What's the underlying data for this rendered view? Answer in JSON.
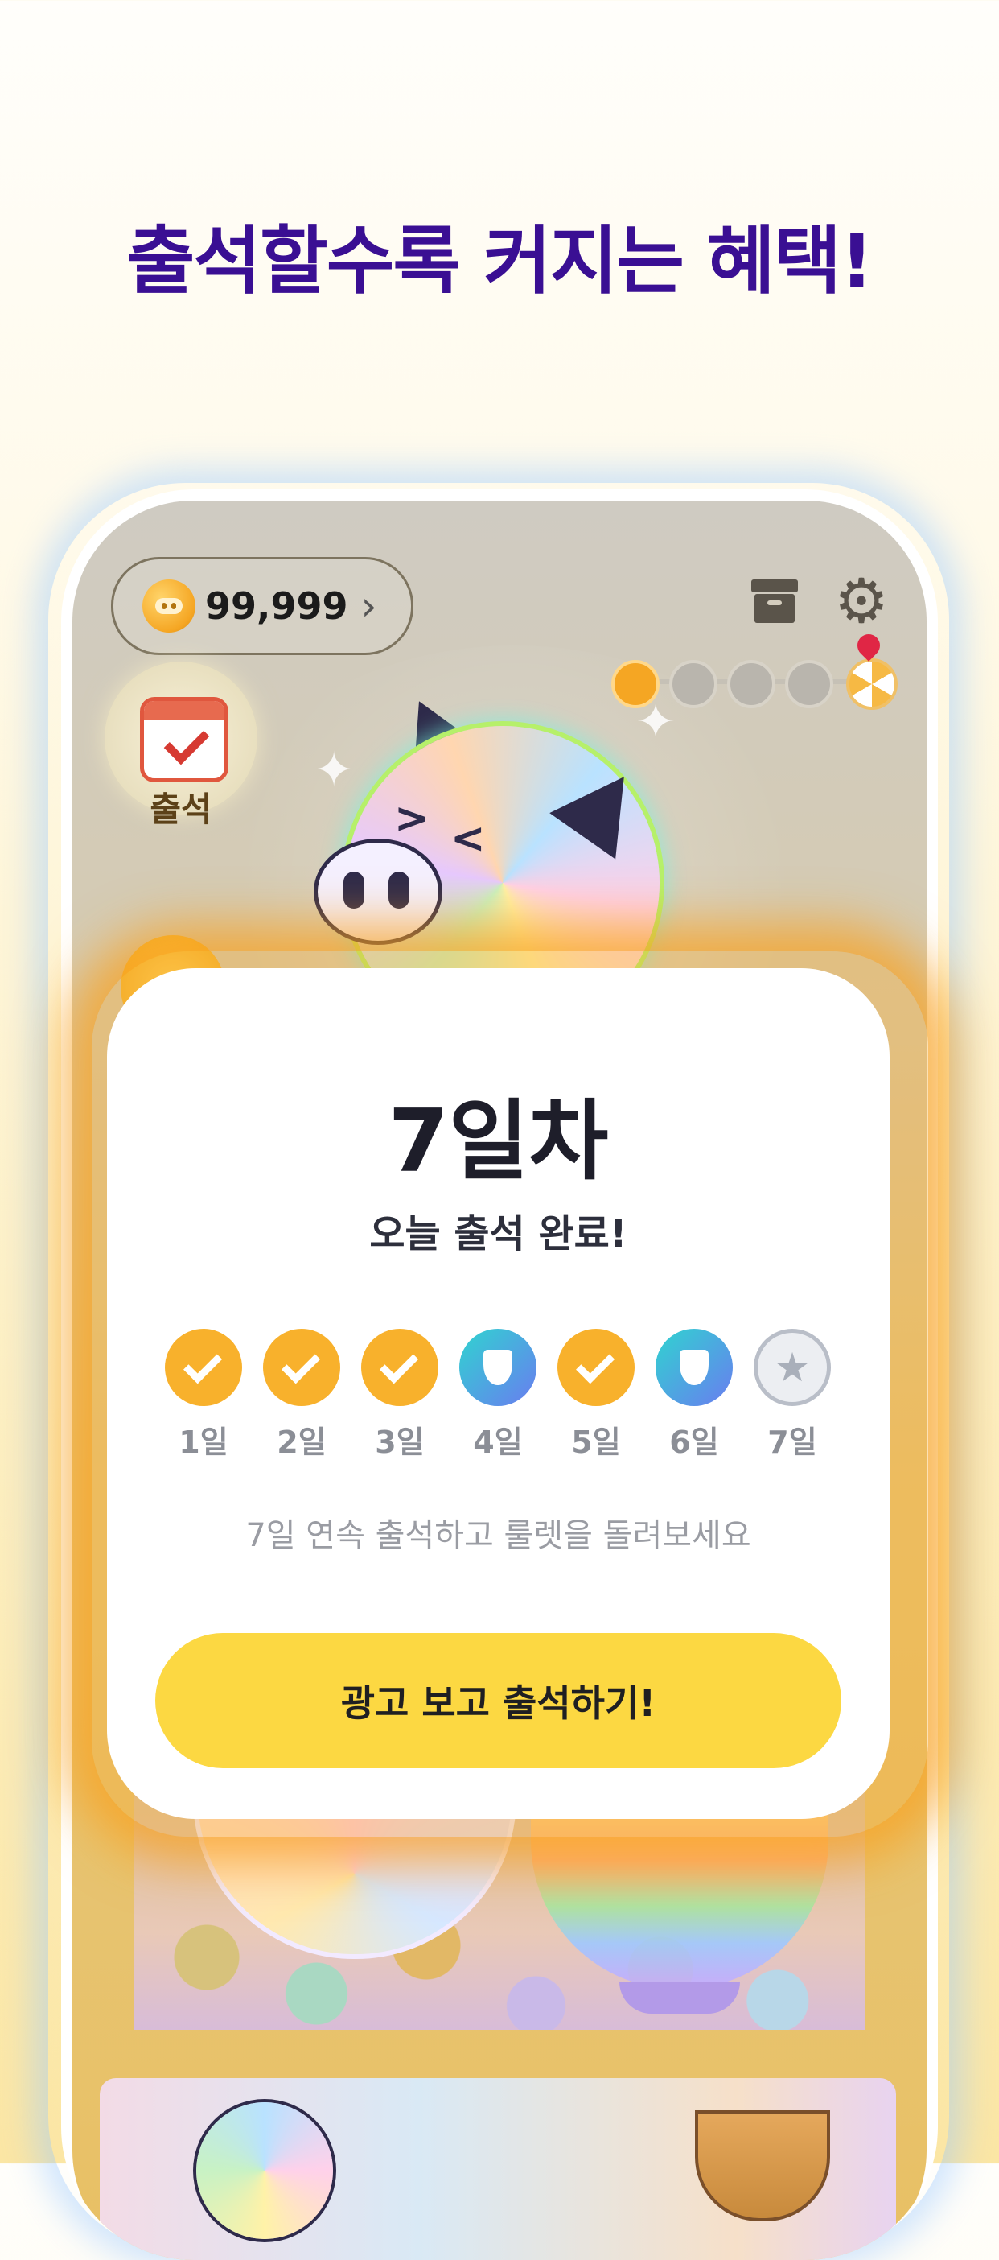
{
  "headline": "출석할수록 커지는 혜택!",
  "topbar": {
    "coin_amount": "99,999",
    "chevron": "›",
    "archive_icon": "archive-icon",
    "settings_icon": "gear-icon"
  },
  "progress": {
    "steps": 4,
    "active_step": 1,
    "goal_icon": "roulette-icon"
  },
  "side_menu": {
    "attendance_label": "출석"
  },
  "modal": {
    "title": "7일차",
    "subtitle": "오늘 출석 완료!",
    "days": [
      {
        "label": "1일",
        "status": "checked"
      },
      {
        "label": "2일",
        "status": "checked"
      },
      {
        "label": "3일",
        "status": "checked"
      },
      {
        "label": "4일",
        "status": "shield"
      },
      {
        "label": "5일",
        "status": "checked"
      },
      {
        "label": "6일",
        "status": "shield"
      },
      {
        "label": "7일",
        "status": "star"
      }
    ],
    "hint": "7일 연속 출석하고 룰렛을 돌려보세요",
    "cta_label": "광고 보고 출석하기!"
  },
  "colors": {
    "headline": "#3a0f93",
    "accent_yellow": "#fcd842",
    "check_orange": "#f8b12c",
    "glow_orange": "#f8a01e"
  }
}
